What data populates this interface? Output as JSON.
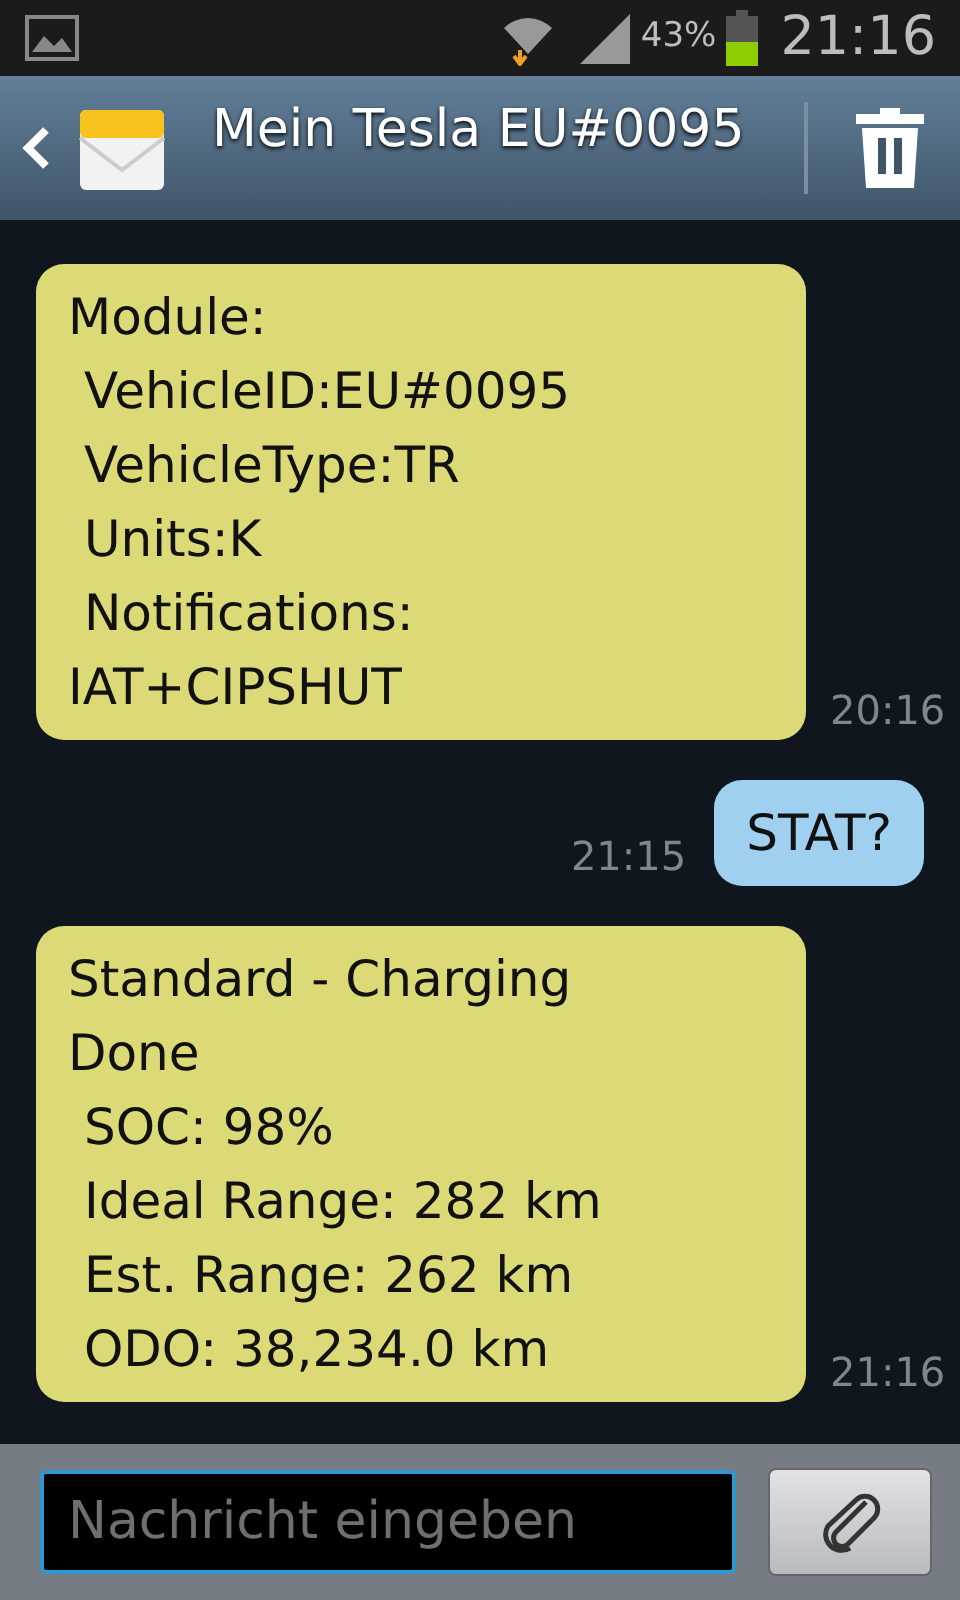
{
  "status_bar": {
    "battery_percent": "43%",
    "time": "21:16"
  },
  "header": {
    "title": "Mein Tesla EU#0095"
  },
  "messages": [
    {
      "kind": "incoming",
      "text": "Module:\n VehicleID:EU#0095\n VehicleType:TR\n Units:K\n Notifications:\nIAT+CIPSHUT",
      "time": "20:16"
    },
    {
      "kind": "outgoing",
      "text": "STAT?",
      "time": "21:15"
    },
    {
      "kind": "incoming",
      "text": "Standard - Charging\nDone\n SOC: 98%\n Ideal Range: 282 km\n Est. Range: 262 km\n ODO: 38,234.0 km",
      "time": "21:16"
    }
  ],
  "composer": {
    "placeholder": "Nachricht eingeben"
  }
}
